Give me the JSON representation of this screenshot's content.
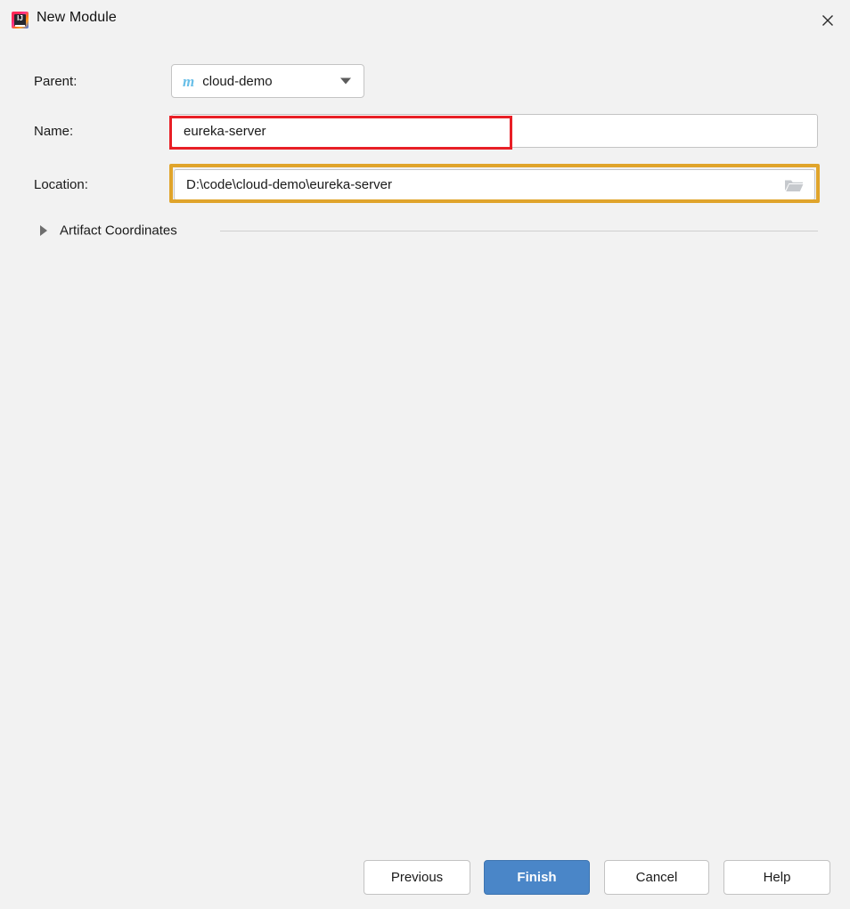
{
  "window": {
    "title": "New Module",
    "app_icon": "intellij-idea-icon",
    "close_icon": "close-icon"
  },
  "form": {
    "parent": {
      "label": "Parent:",
      "value": "cloud-demo",
      "icon": "maven-module-icon",
      "icon_glyph": "m",
      "dropdown_icon": "chevron-down-icon"
    },
    "name": {
      "label": "Name:",
      "value": "eureka-server",
      "placeholder": ""
    },
    "location": {
      "label": "Location:",
      "value": "D:\\code\\cloud-demo\\eureka-server",
      "placeholder": "",
      "browse_icon": "folder-open-icon"
    }
  },
  "artifact_coordinates": {
    "label": "Artifact Coordinates",
    "expanded": false,
    "disclosure_icon": "triangle-right-icon"
  },
  "footer": {
    "previous_label": "Previous",
    "finish_label": "Finish",
    "cancel_label": "Cancel",
    "help_label": "Help"
  },
  "annotations": {
    "name_highlight_color": "#e81f26",
    "location_highlight_color": "#e0a42b"
  },
  "colors": {
    "background": "#f2f2f2",
    "primary_button": "#4a86c8",
    "maven_icon": "#69bfe8",
    "field_border": "#c4c4c4",
    "text": "#1a1a1a"
  }
}
